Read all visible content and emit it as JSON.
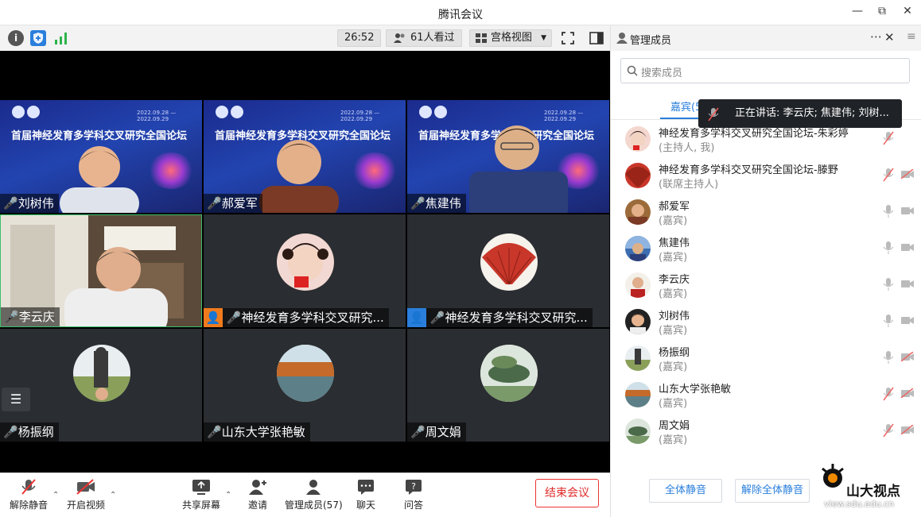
{
  "window": {
    "title": "腾讯会议"
  },
  "toolbar": {
    "timer": "26:52",
    "viewers": "61人看过",
    "view_mode": "宫格视图"
  },
  "tiles": [
    {
      "name": "刘树伟",
      "banner": true
    },
    {
      "name": "郝爱军",
      "banner": true
    },
    {
      "name": "焦建伟",
      "banner": true
    },
    {
      "name": "李云庆",
      "banner": false
    },
    {
      "name": "神经发育多学科交叉研究...",
      "banner": false
    },
    {
      "name": "神经发育多学科交叉研究...",
      "banner": false
    },
    {
      "name": "杨振纲",
      "banner": false
    },
    {
      "name": "山东大学张艳敏",
      "banner": false
    },
    {
      "name": "周文娟",
      "banner": false
    }
  ],
  "banner": {
    "title": "首届神经发育多学科交叉研究全国论坛",
    "date": "2022.09.28 — 2022.09.29"
  },
  "controls": {
    "unmute": "解除静音",
    "video": "开启视频",
    "share": "共享屏幕",
    "invite": "邀请",
    "members": "管理成员(57)",
    "chat": "聊天",
    "qa": "问答",
    "end": "结束会议"
  },
  "panel": {
    "title": "管理成员",
    "search_placeholder": "搜索成员",
    "tab": "嘉宾(5",
    "speaking": "正在讲话: 李云庆; 焦建伟; 刘树...",
    "members": [
      {
        "name": "神经发育多学科交叉研究全国论坛-朱彩婷",
        "role": "(主持人, 我)"
      },
      {
        "name": "神经发育多学科交叉研究全国论坛-滕野",
        "role": "(联席主持人)"
      },
      {
        "name": "郝爱军",
        "role": "(嘉宾)"
      },
      {
        "name": "焦建伟",
        "role": "(嘉宾)"
      },
      {
        "name": "李云庆",
        "role": "(嘉宾)"
      },
      {
        "name": "刘树伟",
        "role": "(嘉宾)"
      },
      {
        "name": "杨振纲",
        "role": "(嘉宾)"
      },
      {
        "name": "山东大学张艳敏",
        "role": "(嘉宾)"
      },
      {
        "name": "周文娟",
        "role": "(嘉宾)"
      }
    ],
    "mute_all": "全体静音",
    "unmute_all": "解除全体静音"
  },
  "watermark": {
    "text": "山大视点",
    "url": "view.sdu.edu.cn"
  }
}
